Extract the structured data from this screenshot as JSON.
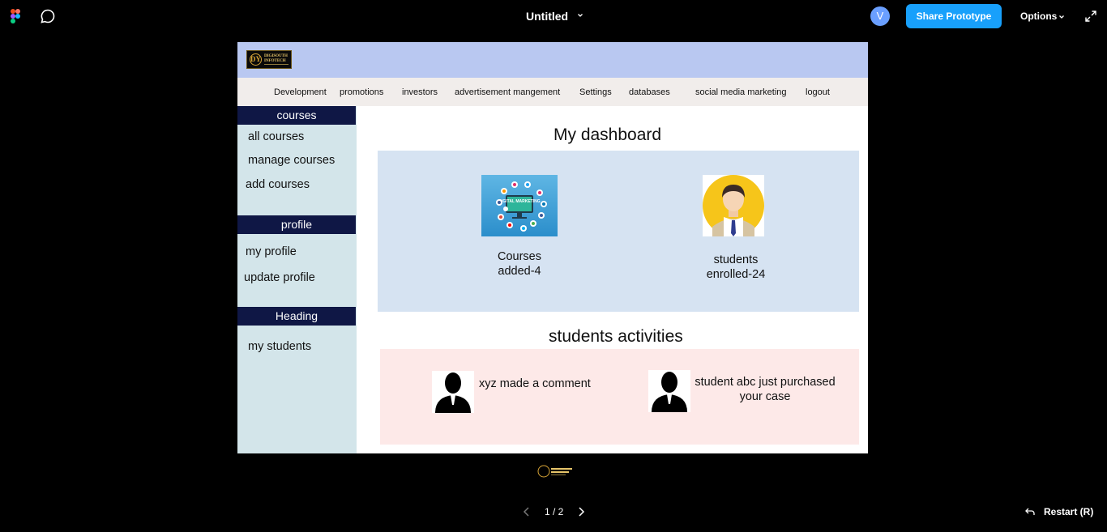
{
  "viewer": {
    "title": "Untitled",
    "avatar_letter": "V",
    "share_label": "Share Prototype",
    "options_label": "Options",
    "page_indicator": "1 / 2",
    "restart_label": "Restart (R)",
    "accent_color": "#18a0fb"
  },
  "site": {
    "logo": {
      "mark": "DY",
      "line1": "DIGISOUTH",
      "line2": "INFOTECH"
    },
    "nav": [
      "Development",
      "promotions",
      "investors",
      "advertisement mangement",
      "Settings",
      "databases",
      "social media marketing",
      "logout"
    ],
    "sidebar": {
      "sections": [
        {
          "heading": "courses",
          "items": [
            "all courses",
            "manage courses",
            "add courses"
          ]
        },
        {
          "heading": "profile",
          "items": [
            "my profile",
            "update profile"
          ]
        },
        {
          "heading": "Heading",
          "items": [
            "my students"
          ]
        }
      ]
    },
    "dashboard_title": "My dashboard",
    "stats": [
      {
        "line1": "Courses",
        "line2": "added-4",
        "image": "digital-marketing-image",
        "image_text": "DIGITAL MARKETING"
      },
      {
        "line1": "students",
        "line2": "enrolled-24",
        "image": "student-avatar-image"
      }
    ],
    "activities_title": "students activities",
    "activities": [
      {
        "text": "xyz made a comment"
      },
      {
        "line1": "student abc just purchased",
        "line2": "your case"
      }
    ]
  }
}
